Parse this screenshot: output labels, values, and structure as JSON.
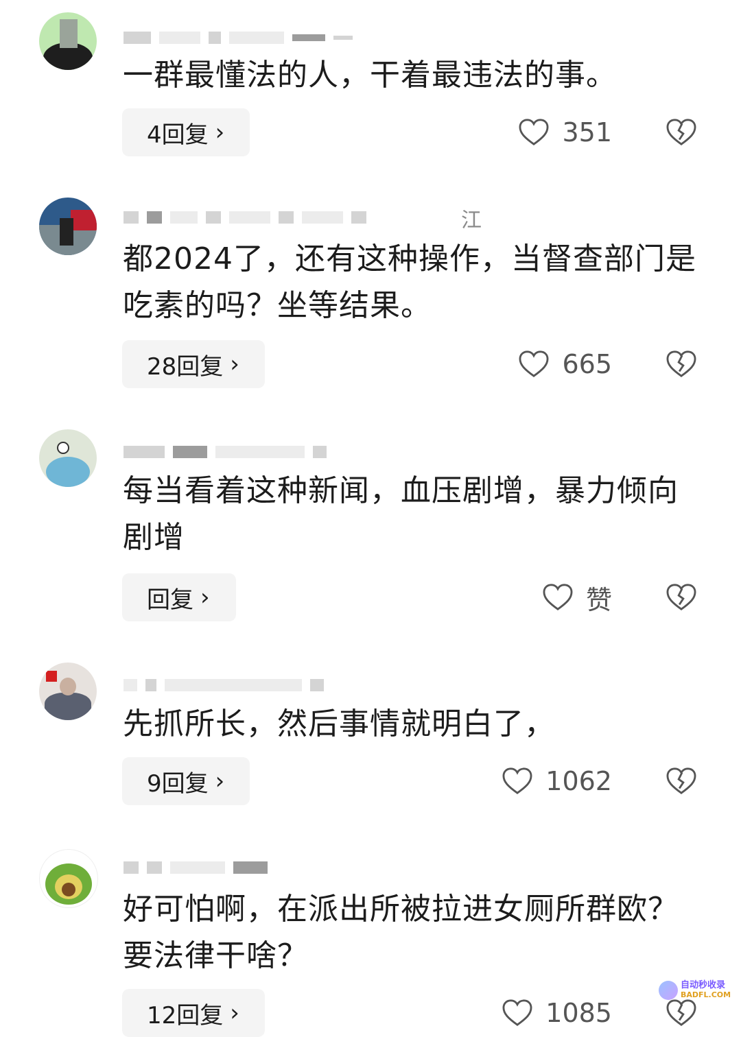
{
  "comments": [
    {
      "location": "",
      "text": "一群最懂法的人，干着最违法的事。",
      "reply_label": "4回复",
      "like_label": "351"
    },
    {
      "location": "江",
      "text": "都2024了，还有这种操作，当督查部门是吃素的吗？坐等结果。",
      "reply_label": "28回复",
      "like_label": "665"
    },
    {
      "location": "",
      "text": "每当看着这种新闻，血压剧增，暴力倾向剧增",
      "reply_label": "回复",
      "like_label": "赞"
    },
    {
      "location": "",
      "text": "先抓所长，然后事情就明白了，",
      "reply_label": "9回复",
      "like_label": "1062"
    },
    {
      "location": "",
      "text": "好可怕啊，在派出所被拉进女厕所群欧？要法律干啥？",
      "reply_label": "12回复",
      "like_label": "1085"
    }
  ],
  "reply_chevron": "›",
  "icons": {
    "like": "heart-outline-icon",
    "dislike": "broken-heart-icon",
    "reply": "chevron-right-icon"
  },
  "watermark": {
    "line1": "自动秒收录",
    "line2": "BADFL.COM"
  }
}
